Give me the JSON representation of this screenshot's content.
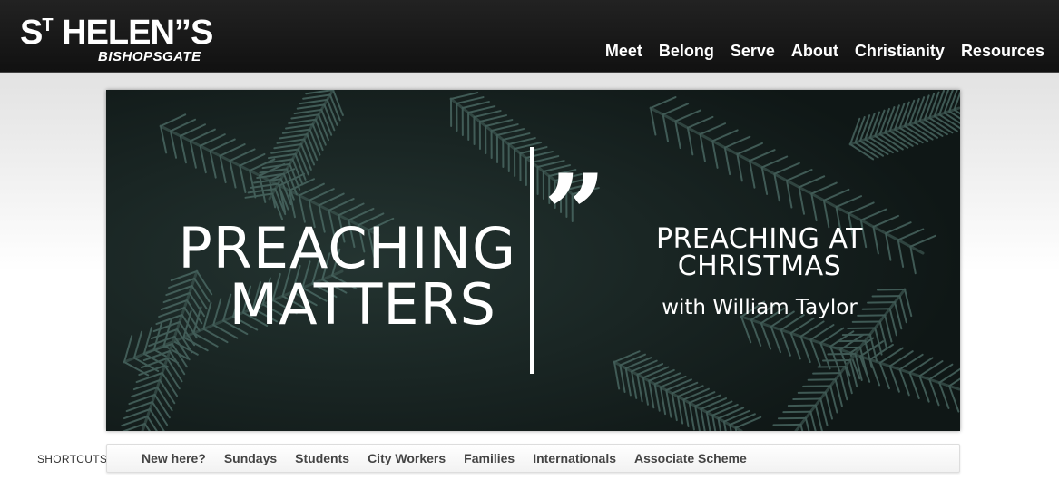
{
  "header": {
    "logo": {
      "main": "ST HELEN",
      "super": "T",
      "prefix": "S",
      "rest": " HELEN”",
      "end": "S",
      "sub": "BISHOPSGATE"
    },
    "nav": [
      "Meet",
      "Belong",
      "Serve",
      "About",
      "Christianity",
      "Resources"
    ]
  },
  "banner": {
    "title_line1": "PREACHING",
    "title_line2": "MATTERS",
    "quote_mark": "”",
    "subtitle": "PREACHING AT CHRISTMAS",
    "subtitle_line1": "PREACHING AT",
    "subtitle_line2": "CHRISTMAS",
    "with_text": "with William Taylor"
  },
  "shortcuts": {
    "label": "SHORTCUTS",
    "items": [
      "New here?",
      "Sundays",
      "Students",
      "City Workers",
      "Families",
      "Internationals",
      "Associate Scheme"
    ]
  }
}
